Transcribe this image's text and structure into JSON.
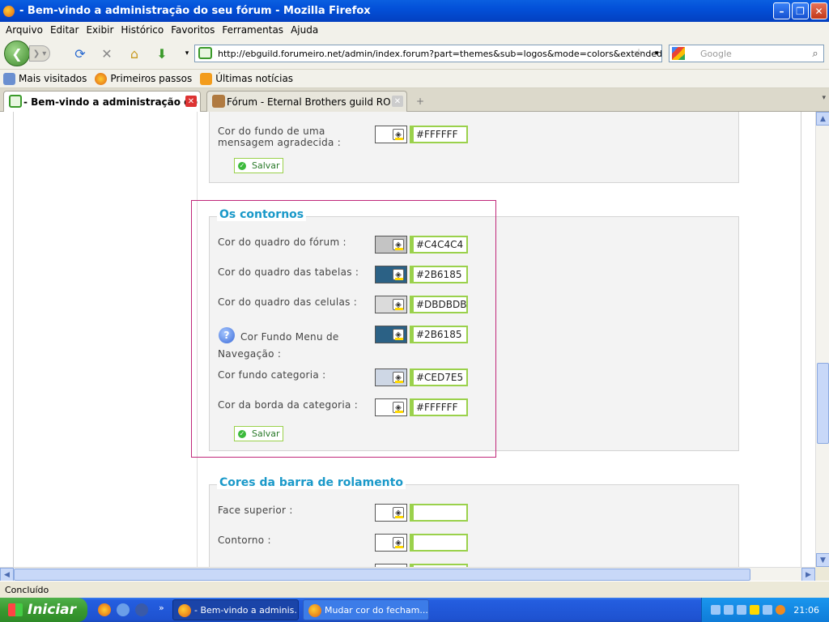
{
  "window": {
    "title": "- Bem-vindo a administração do seu fórum - Mozilla Firefox"
  },
  "menu": [
    "Arquivo",
    "Editar",
    "Exibir",
    "Histórico",
    "Favoritos",
    "Ferramentas",
    "Ajuda"
  ],
  "nav": {
    "url": "http://ebguild.forumeiro.net/admin/index.forum?part=themes&sub=logos&mode=colors&extended_admi",
    "search_placeholder": "Google"
  },
  "bookmarks": [
    {
      "label": "Mais visitados",
      "icon": "bookmark-star-icon"
    },
    {
      "label": "Primeiros passos",
      "icon": "firefox-icon"
    },
    {
      "label": "Últimas notícias",
      "icon": "rss-icon"
    }
  ],
  "tabs": [
    {
      "label": "- Bem-vindo a administração do ...",
      "active": true
    },
    {
      "label": "Fórum - Eternal Brothers guild RO",
      "active": false
    }
  ],
  "sections": {
    "top": {
      "label": "Cor do fundo de uma mensagem agradecida  :",
      "hex": "#FFFFFF",
      "color": "#FFFFFF",
      "save": "Salvar"
    },
    "contornos": {
      "title": "Os contornos",
      "fields": [
        {
          "label": "Cor do quadro do fórum  :",
          "hex": "#C4C4C4",
          "color": "#C4C4C4"
        },
        {
          "label": "Cor do quadro das tabelas  :",
          "hex": "#2B6185",
          "color": "#2B6185"
        },
        {
          "label": "Cor do quadro das celulas  :",
          "hex": "#DBDBDB",
          "color": "#DBDBDB"
        },
        {
          "label": "Cor Fundo Menu de Navegação  :",
          "hex": "#2B6185",
          "color": "#2B6185"
        },
        {
          "label": "Cor fundo categoria  :",
          "hex": "#CED7E5",
          "color": "#CED7E5"
        },
        {
          "label": "Cor da borda da categoria  :",
          "hex": "#FFFFFF",
          "color": "#FFFFFF"
        }
      ],
      "save": "Salvar"
    },
    "rolamento": {
      "title": "Cores da barra de rolamento",
      "fields": [
        {
          "label": "Face superior  :",
          "hex": ""
        },
        {
          "label": "Contorno  :",
          "hex": ""
        }
      ]
    }
  },
  "status": "Concluído",
  "taskbar": {
    "start": "Iniciar",
    "tasks": [
      "- Bem-vindo a adminis...",
      "Mudar cor do fecham..."
    ],
    "clock": "21:06"
  },
  "colors": {
    "accent": "#1A99C9",
    "highlight": "#C0287A",
    "hexBorder": "#9AD14B"
  }
}
